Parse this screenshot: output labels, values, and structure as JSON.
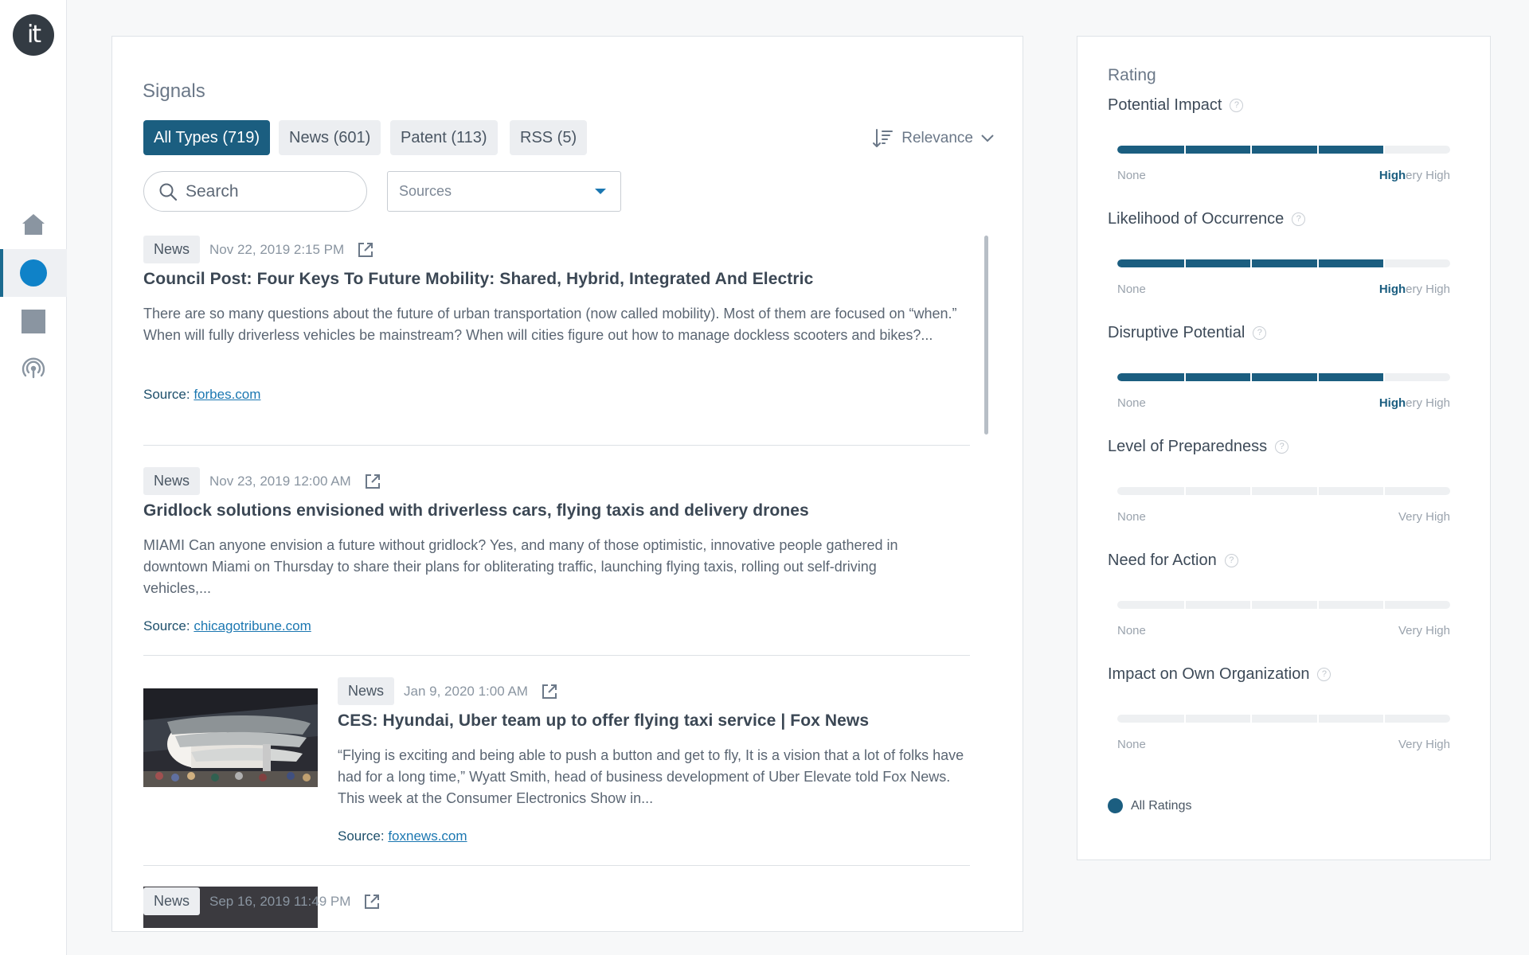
{
  "sidebar": {
    "logo_text": "it",
    "items": [
      {
        "name": "home",
        "icon": "home-icon"
      },
      {
        "name": "signals",
        "icon": "circle-icon",
        "active": true
      },
      {
        "name": "square",
        "icon": "square-icon"
      },
      {
        "name": "broadcast",
        "icon": "broadcast-icon"
      }
    ]
  },
  "signals": {
    "title": "Signals",
    "chips": {
      "all": "All Types (719)",
      "news": "News (601)",
      "patent": "Patent (113)",
      "rss": "RSS (5)"
    },
    "sort_label": "Relevance",
    "search_placeholder": "Search",
    "sources_label": "Sources",
    "source_prefix": "Source:",
    "articles": [
      {
        "type": "News",
        "date": "Nov 22, 2019 2:15 PM",
        "title": "Council Post: Four Keys To Future Mobility: Shared, Hybrid, Integrated And Electric",
        "body": "There are so many questions about the future of urban transportation (now called mobility). Most of them are focused on “when.” When will fully driverless vehicles be mainstream? When will cities figure out how to manage dockless scooters and bikes?...",
        "source": "forbes.com"
      },
      {
        "type": "News",
        "date": "Nov 23, 2019 12:00 AM",
        "title": "Gridlock solutions envisioned with driverless cars, flying taxis and delivery drones",
        "body": "MIAMI Can anyone envision a future without gridlock? Yes, and many of those optimistic, innovative people gathered in downtown Miami on Thursday to share their plans for obliterating traffic, launching flying taxis, rolling out self-driving vehicles,...",
        "source": "chicagotribune.com"
      },
      {
        "type": "News",
        "date": "Jan 9, 2020 1:00 AM",
        "title": "CES: Hyundai, Uber team up to offer flying taxi service | Fox News",
        "body": "“Flying is exciting and being able to push a button and get to fly, It is a vision that a lot of folks have had for a long time,” Wyatt Smith, head of business development of Uber Elevate told Fox News. This week at the Consumer Electronics Show in...",
        "source": "foxnews.com"
      },
      {
        "type": "News",
        "date": "Sep 16, 2019 11:49 PM"
      }
    ]
  },
  "rating": {
    "title": "Rating",
    "scale_low": "None",
    "metrics": [
      {
        "label": "Potential Impact",
        "level": 0.8,
        "high_prefix": "High",
        "high_suffix": "ery High"
      },
      {
        "label": "Likelihood of Occurrence",
        "level": 0.8,
        "high_prefix": "High",
        "high_suffix": "ery High"
      },
      {
        "label": "Disruptive Potential",
        "level": 0.8,
        "high_prefix": "High",
        "high_suffix": "ery High"
      },
      {
        "label": "Level of Preparedness",
        "level": 0,
        "high_prefix": "",
        "high_suffix": "Very High"
      },
      {
        "label": "Need for Action",
        "level": 0,
        "high_prefix": "",
        "high_suffix": "Very High"
      },
      {
        "label": "Impact on Own Organization",
        "level": 0,
        "high_prefix": "",
        "high_suffix": "Very High"
      }
    ],
    "help_glyph": "?",
    "legend_label": "All Ratings"
  },
  "colors": {
    "accent": "#1b5e80",
    "link": "#1b77b1",
    "active_dot": "#0f82c8"
  }
}
